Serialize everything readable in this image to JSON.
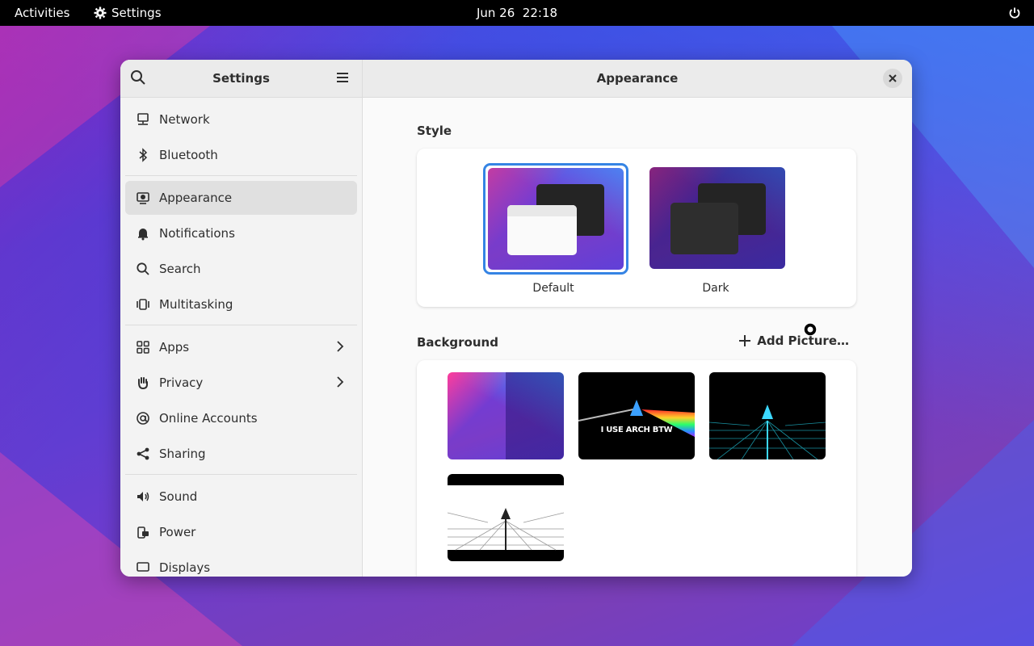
{
  "topbar": {
    "activities": "Activities",
    "app_name": "Settings",
    "date": "Jun 26",
    "time": "22:18"
  },
  "sidebar": {
    "title": "Settings",
    "items": [
      {
        "label": "Network",
        "icon": "network-icon"
      },
      {
        "label": "Bluetooth",
        "icon": "bluetooth-icon"
      },
      {
        "label": "Appearance",
        "icon": "appearance-icon",
        "active": true
      },
      {
        "label": "Notifications",
        "icon": "bell-icon"
      },
      {
        "label": "Search",
        "icon": "search-icon"
      },
      {
        "label": "Multitasking",
        "icon": "multitasking-icon"
      },
      {
        "label": "Apps",
        "icon": "apps-grid-icon",
        "chevron": true
      },
      {
        "label": "Privacy",
        "icon": "hand-icon",
        "chevron": true
      },
      {
        "label": "Online Accounts",
        "icon": "at-sign-icon"
      },
      {
        "label": "Sharing",
        "icon": "share-icon"
      },
      {
        "label": "Sound",
        "icon": "speaker-icon"
      },
      {
        "label": "Power",
        "icon": "power-plug-icon"
      },
      {
        "label": "Displays",
        "icon": "display-icon"
      }
    ]
  },
  "main": {
    "title": "Appearance",
    "style_section": {
      "label": "Style",
      "options": [
        {
          "label": "Default",
          "selected": true
        },
        {
          "label": "Dark",
          "selected": false
        }
      ]
    },
    "background_section": {
      "label": "Background",
      "add_picture": "Add Picture…",
      "wallpapers": [
        {
          "name": "default-wallpaper"
        },
        {
          "name": "arch-prism-wallpaper",
          "text": "I USE ARCH BTW"
        },
        {
          "name": "arch-neon-grid-wallpaper"
        },
        {
          "name": "arch-white-grid-wallpaper"
        }
      ]
    }
  },
  "colors": {
    "accent": "#3584e4",
    "topbar": "#000000",
    "window_bg": "#fafafa",
    "sidebar_bg": "#f3f3f3"
  }
}
